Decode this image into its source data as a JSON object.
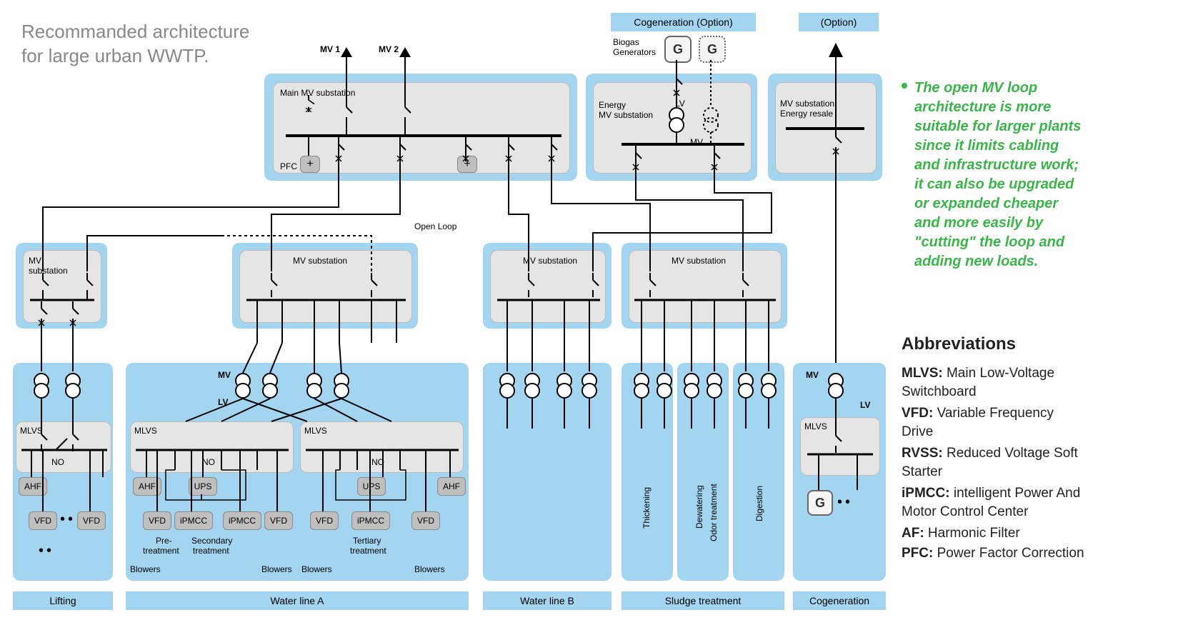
{
  "title_l1": "Recommanded architecture",
  "title_l2": "for large urban WWTP.",
  "callout": "The open MV loop architecture is more suitable for larger plants since it limits cabling and infrastructure work; it can also be upgraded or expanded cheaper and more easily by \"cutting\" the loop and adding new loads.",
  "abbr_title": "Abbreviations",
  "abbr": {
    "mlvs": {
      "k": "MLVS:",
      "v": " Main Low-Voltage Switchboard"
    },
    "vfd": {
      "k": "VFD:",
      "v": " Variable Frequency Drive"
    },
    "rvss": {
      "k": "RVSS:",
      "v": " Reduced Voltage Soft Starter"
    },
    "ipmcc": {
      "k": "iPMCC:",
      "v": " intelligent Power And Motor Control Center"
    },
    "af": {
      "k": "AF:",
      "v": " Harmonic Filter"
    },
    "pfc": {
      "k": "PFC:",
      "v": " Power Factor Correction"
    }
  },
  "bars": {
    "lifting": "Lifting",
    "wla": "Water line A",
    "wlb": "Water line B",
    "sludge": "Sludge treatment",
    "cogen": "Cogeneration",
    "cogen_opt": "Cogeneration (Option)",
    "opt": "(Option)"
  },
  "labels": {
    "mv1": "MV 1",
    "mv2": "MV 2",
    "main_sub": "Main MV substation",
    "pfc": "PFC",
    "mv_sub": "MV substation",
    "mv_sub2": "MV\nsubstation",
    "energy_sub_l1": "Energy",
    "energy_sub_l2": "MV substation",
    "biogas_l1": "Biogas",
    "biogas_l2": "Generators",
    "resale_l1": "MV substation",
    "resale_l2": "Energy resale",
    "mv": "MV",
    "lv": "LV",
    "mlvs": "MLVS",
    "no": "NO",
    "open_loop": "Open Loop",
    "ahf": "AHF",
    "vfd": "VFD",
    "ups": "UPS",
    "ipmcc": "iPMCC",
    "g": "G",
    "thick": "Thickening",
    "dewater": "Dewatering",
    "odor": "Odor treatment",
    "digest": "Digestion",
    "blowers": "Blowers",
    "pretreat_l1": "Pre-",
    "pretreat_l2": "treatment",
    "sectreat_l1": "Secondary",
    "sectreat_l2": "treatment",
    "terttreat_l1": "Tertiary",
    "terttreat_l2": "treatment"
  }
}
